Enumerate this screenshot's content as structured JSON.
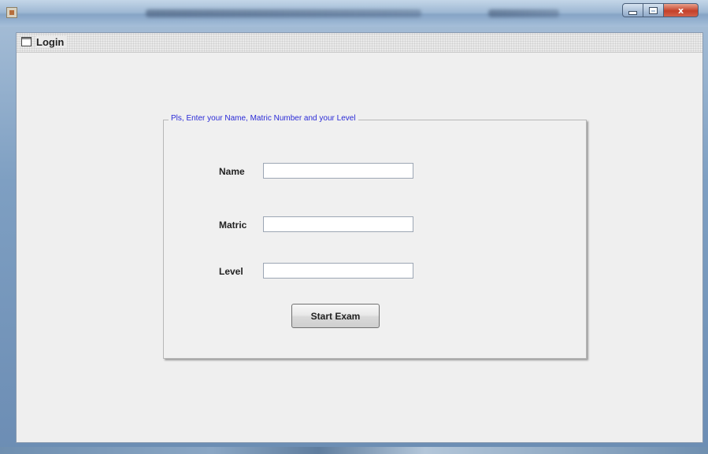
{
  "window": {
    "title": "",
    "controls": {
      "minimize": "",
      "maximize": "",
      "close": "x"
    }
  },
  "internal_frame": {
    "title": "Login"
  },
  "form": {
    "legend": "Pls, Enter your Name, Matric Number and your Level",
    "fields": [
      {
        "label": "Name",
        "value": ""
      },
      {
        "label": "Matric",
        "value": ""
      },
      {
        "label": "Level",
        "value": ""
      }
    ],
    "submit_label": "Start Exam"
  },
  "colors": {
    "legend_text": "#2a2ad6",
    "client_bg": "#efefef"
  },
  "icons": [
    "app-icon",
    "internal-frame-icon",
    "minimize-icon",
    "maximize-icon",
    "close-icon"
  ]
}
